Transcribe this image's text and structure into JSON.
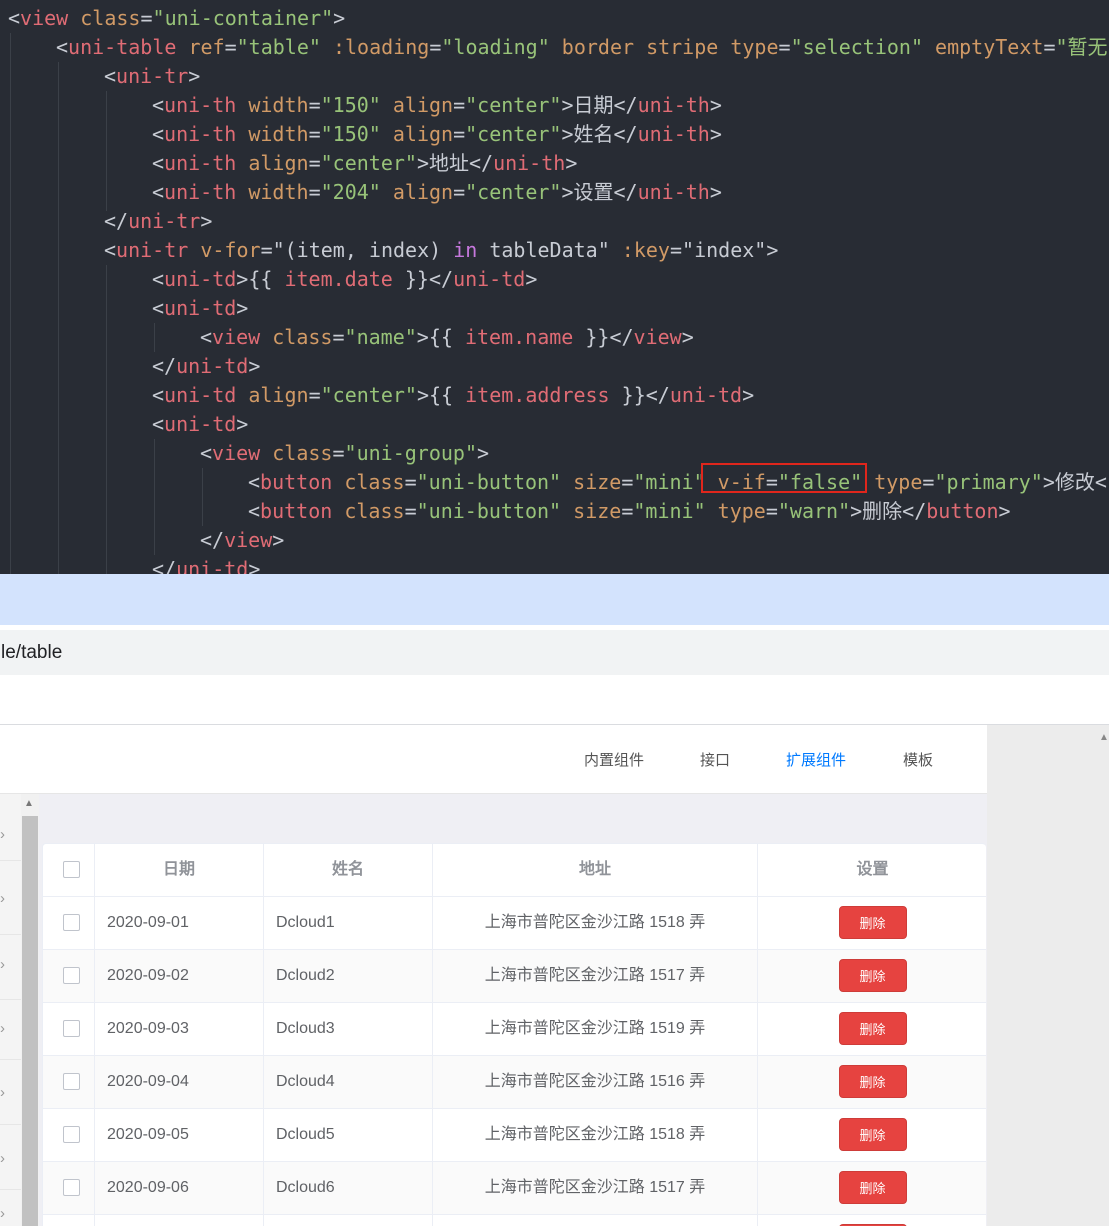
{
  "editor": {
    "lines": [
      [
        [
          "t-txt",
          "<"
        ],
        [
          "t-tag",
          "view "
        ],
        [
          "t-attr",
          "class"
        ],
        [
          "t-txt",
          "="
        ],
        [
          "t-str",
          "\"uni-container\""
        ],
        [
          "t-txt",
          ">"
        ]
      ],
      [
        [
          "t-txt",
          "<"
        ],
        [
          "t-tag",
          "uni-table "
        ],
        [
          "t-attr",
          "ref"
        ],
        [
          "t-txt",
          "="
        ],
        [
          "t-str",
          "\"table\""
        ],
        [
          "t-attr",
          " :loading"
        ],
        [
          "t-txt",
          "="
        ],
        [
          "t-str",
          "\"loading\""
        ],
        [
          "t-attr",
          " border stripe type"
        ],
        [
          "t-txt",
          "="
        ],
        [
          "t-str",
          "\"selection\""
        ],
        [
          "t-attr",
          " emptyText"
        ],
        [
          "t-txt",
          "="
        ],
        [
          "t-str",
          "\"暂无"
        ]
      ],
      [
        [
          "t-txt",
          "<"
        ],
        [
          "t-tag",
          "uni-tr"
        ],
        [
          "t-txt",
          ">"
        ]
      ],
      [
        [
          "t-txt",
          "<"
        ],
        [
          "t-tag",
          "uni-th "
        ],
        [
          "t-attr",
          "width"
        ],
        [
          "t-txt",
          "="
        ],
        [
          "t-str",
          "\"150\""
        ],
        [
          "t-attr",
          " align"
        ],
        [
          "t-txt",
          "="
        ],
        [
          "t-str",
          "\"center\""
        ],
        [
          "t-txt",
          ">日期</"
        ],
        [
          "t-tag",
          "uni-th"
        ],
        [
          "t-txt",
          ">"
        ]
      ],
      [
        [
          "t-txt",
          "<"
        ],
        [
          "t-tag",
          "uni-th "
        ],
        [
          "t-attr",
          "width"
        ],
        [
          "t-txt",
          "="
        ],
        [
          "t-str",
          "\"150\""
        ],
        [
          "t-attr",
          " align"
        ],
        [
          "t-txt",
          "="
        ],
        [
          "t-str",
          "\"center\""
        ],
        [
          "t-txt",
          ">姓名</"
        ],
        [
          "t-tag",
          "uni-th"
        ],
        [
          "t-txt",
          ">"
        ]
      ],
      [
        [
          "t-txt",
          "<"
        ],
        [
          "t-tag",
          "uni-th "
        ],
        [
          "t-attr",
          "align"
        ],
        [
          "t-txt",
          "="
        ],
        [
          "t-str",
          "\"center\""
        ],
        [
          "t-txt",
          ">地址</"
        ],
        [
          "t-tag",
          "uni-th"
        ],
        [
          "t-txt",
          ">"
        ]
      ],
      [
        [
          "t-txt",
          "<"
        ],
        [
          "t-tag",
          "uni-th "
        ],
        [
          "t-attr",
          "width"
        ],
        [
          "t-txt",
          "="
        ],
        [
          "t-str",
          "\"204\""
        ],
        [
          "t-attr",
          " align"
        ],
        [
          "t-txt",
          "="
        ],
        [
          "t-str",
          "\"center\""
        ],
        [
          "t-txt",
          ">设置</"
        ],
        [
          "t-tag",
          "uni-th"
        ],
        [
          "t-txt",
          ">"
        ]
      ],
      [
        [
          "t-txt",
          "</"
        ],
        [
          "t-tag",
          "uni-tr"
        ],
        [
          "t-txt",
          ">"
        ]
      ],
      [
        [
          "t-txt",
          "<"
        ],
        [
          "t-tag",
          "uni-tr "
        ],
        [
          "t-attr",
          "v-for"
        ],
        [
          "t-txt",
          "=\"(item, index) "
        ],
        [
          "t-kw",
          "in"
        ],
        [
          "t-txt",
          " tableData\""
        ],
        [
          "t-attr",
          " :key"
        ],
        [
          "t-txt",
          "="
        ],
        [
          "t-txt",
          "\"index\">"
        ]
      ],
      [
        [
          "t-txt",
          "<"
        ],
        [
          "t-tag",
          "uni-td"
        ],
        [
          "t-txt",
          ">{{ "
        ],
        [
          "t-tag",
          "item.date"
        ],
        [
          "t-txt",
          " }}</"
        ],
        [
          "t-tag",
          "uni-td"
        ],
        [
          "t-txt",
          ">"
        ]
      ],
      [
        [
          "t-txt",
          "<"
        ],
        [
          "t-tag",
          "uni-td"
        ],
        [
          "t-txt",
          ">"
        ]
      ],
      [
        [
          "t-txt",
          "<"
        ],
        [
          "t-tag",
          "view "
        ],
        [
          "t-attr",
          "class"
        ],
        [
          "t-txt",
          "="
        ],
        [
          "t-str",
          "\"name\""
        ],
        [
          "t-txt",
          ">{{ "
        ],
        [
          "t-tag",
          "item.name"
        ],
        [
          "t-txt",
          " }}</"
        ],
        [
          "t-tag",
          "view"
        ],
        [
          "t-txt",
          ">"
        ]
      ],
      [
        [
          "t-txt",
          "</"
        ],
        [
          "t-tag",
          "uni-td"
        ],
        [
          "t-txt",
          ">"
        ]
      ],
      [
        [
          "t-txt",
          "<"
        ],
        [
          "t-tag",
          "uni-td "
        ],
        [
          "t-attr",
          "align"
        ],
        [
          "t-txt",
          "="
        ],
        [
          "t-str",
          "\"center\""
        ],
        [
          "t-txt",
          ">{{ "
        ],
        [
          "t-tag",
          "item.address"
        ],
        [
          "t-txt",
          " }}</"
        ],
        [
          "t-tag",
          "uni-td"
        ],
        [
          "t-txt",
          ">"
        ]
      ],
      [
        [
          "t-txt",
          "<"
        ],
        [
          "t-tag",
          "uni-td"
        ],
        [
          "t-txt",
          ">"
        ]
      ],
      [
        [
          "t-txt",
          "<"
        ],
        [
          "t-tag",
          "view "
        ],
        [
          "t-attr",
          "class"
        ],
        [
          "t-txt",
          "="
        ],
        [
          "t-str",
          "\"uni-group\""
        ],
        [
          "t-txt",
          ">"
        ]
      ],
      [
        [
          "t-txt",
          "<"
        ],
        [
          "t-tag",
          "button "
        ],
        [
          "t-attr",
          "class"
        ],
        [
          "t-txt",
          "="
        ],
        [
          "t-str",
          "\"uni-button\""
        ],
        [
          "t-attr",
          " size"
        ],
        [
          "t-txt",
          "="
        ],
        [
          "t-str",
          "\"mini\""
        ],
        [
          "t-attr",
          " v-if"
        ],
        [
          "t-txt",
          "="
        ],
        [
          "t-str",
          "\"false\""
        ],
        [
          "t-attr",
          " type"
        ],
        [
          "t-txt",
          "="
        ],
        [
          "t-str",
          "\"primary\""
        ],
        [
          "t-txt",
          ">修改<"
        ]
      ],
      [
        [
          "t-txt",
          "<"
        ],
        [
          "t-tag",
          "button "
        ],
        [
          "t-attr",
          "class"
        ],
        [
          "t-txt",
          "="
        ],
        [
          "t-str",
          "\"uni-button\""
        ],
        [
          "t-attr",
          " size"
        ],
        [
          "t-txt",
          "="
        ],
        [
          "t-str",
          "\"mini\""
        ],
        [
          "t-attr",
          " type"
        ],
        [
          "t-txt",
          "="
        ],
        [
          "t-str",
          "\"warn\""
        ],
        [
          "t-txt",
          ">删除</"
        ],
        [
          "t-tag",
          "button"
        ],
        [
          "t-txt",
          ">"
        ]
      ],
      [
        [
          "t-txt",
          "</"
        ],
        [
          "t-tag",
          "view"
        ],
        [
          "t-txt",
          ">"
        ]
      ],
      [
        [
          "t-txt",
          "</"
        ],
        [
          "t-tag",
          "uni-td"
        ],
        [
          "t-txt",
          ">"
        ]
      ]
    ]
  },
  "browser": {
    "address_text": "le/table"
  },
  "nav": {
    "items": [
      {
        "label": "内置组件",
        "active": false
      },
      {
        "label": "接口",
        "active": false
      },
      {
        "label": "扩展组件",
        "active": true
      },
      {
        "label": "模板",
        "active": false
      }
    ],
    "active_color": "#007aff"
  },
  "table": {
    "headers": [
      "日期",
      "姓名",
      "地址",
      "设置"
    ],
    "delete_label": "删除",
    "delete_color": "#e64340",
    "rows": [
      {
        "date": "2020-09-01",
        "name": "Dcloud1",
        "address": "上海市普陀区金沙江路 1518 弄"
      },
      {
        "date": "2020-09-02",
        "name": "Dcloud2",
        "address": "上海市普陀区金沙江路 1517 弄"
      },
      {
        "date": "2020-09-03",
        "name": "Dcloud3",
        "address": "上海市普陀区金沙江路 1519 弄"
      },
      {
        "date": "2020-09-04",
        "name": "Dcloud4",
        "address": "上海市普陀区金沙江路 1516 弄"
      },
      {
        "date": "2020-09-05",
        "name": "Dcloud5",
        "address": "上海市普陀区金沙江路 1518 弄"
      },
      {
        "date": "2020-09-06",
        "name": "Dcloud6",
        "address": "上海市普陀区金沙江路 1517 弄"
      },
      {
        "date": "",
        "name": "",
        "address": ""
      }
    ]
  },
  "sidebar": {
    "arrow_glyph": "›"
  }
}
